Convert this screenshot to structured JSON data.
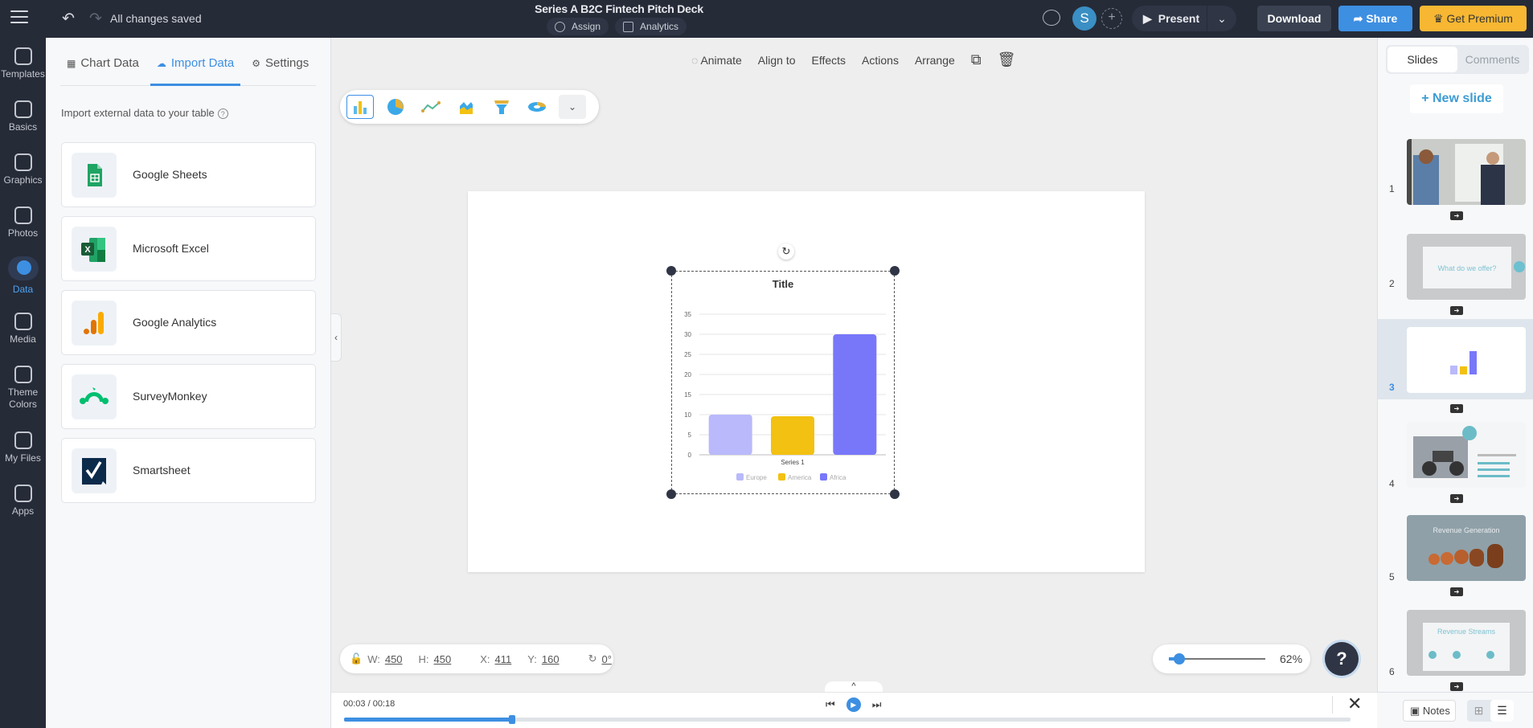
{
  "topbar": {
    "save_status": "All changes saved",
    "doc_title": "Series A B2C Fintech Pitch Deck",
    "assign_label": "Assign",
    "analytics_label": "Analytics",
    "avatar_initial": "S",
    "present_label": "Present",
    "download_label": "Download",
    "share_label": "Share",
    "premium_label": "Get Premium"
  },
  "leftnav": {
    "items": [
      {
        "label": "Templates",
        "icon": "templates-icon"
      },
      {
        "label": "Basics",
        "icon": "text-icon"
      },
      {
        "label": "Graphics",
        "icon": "shapes-icon"
      },
      {
        "label": "Photos",
        "icon": "photo-icon"
      },
      {
        "label": "Data",
        "icon": "pie-chart-icon",
        "active": true
      },
      {
        "label": "Media",
        "icon": "media-icon"
      },
      {
        "label": "Theme Colors",
        "icon": "theme-icon"
      },
      {
        "label": "My Files",
        "icon": "folder-icon"
      },
      {
        "label": "Apps",
        "icon": "apps-icon"
      }
    ]
  },
  "panel": {
    "tabs": [
      {
        "label": "Chart Data",
        "icon": "table-icon"
      },
      {
        "label": "Import Data",
        "icon": "cloud-upload-icon",
        "active": true
      },
      {
        "label": "Settings",
        "icon": "gear-icon"
      }
    ],
    "import_label": "Import external data to your table",
    "sources": [
      {
        "name": "Google Sheets"
      },
      {
        "name": "Microsoft Excel"
      },
      {
        "name": "Google Analytics"
      },
      {
        "name": "SurveyMonkey"
      },
      {
        "name": "Smartsheet"
      }
    ]
  },
  "context_toolbar": {
    "animate": "Animate",
    "align": "Align to",
    "effects": "Effects",
    "actions": "Actions",
    "arrange": "Arrange"
  },
  "chart_types": [
    "bar",
    "pie",
    "line",
    "area",
    "funnel",
    "donut"
  ],
  "chart_data": {
    "type": "bar",
    "title": "Title",
    "categories": [
      "Series 1"
    ],
    "series": [
      {
        "name": "Europe",
        "values": [
          10
        ],
        "color": "#b9b9fb"
      },
      {
        "name": "America",
        "values": [
          9.6
        ],
        "color": "#f2c111"
      },
      {
        "name": "Africa",
        "values": [
          30
        ],
        "color": "#7877fa"
      }
    ],
    "xlabel": "",
    "ylabel": "",
    "ylim": [
      0,
      35
    ],
    "yticks": [
      0,
      5,
      10,
      15,
      20,
      25,
      30,
      35
    ],
    "grid": true,
    "legend": "bottom"
  },
  "geometry_bar": {
    "w_label": "W:",
    "w": "450",
    "h_label": "H:",
    "h": "450",
    "x_label": "X:",
    "x": "411",
    "y_label": "Y:",
    "y": "160",
    "rotation": "0°"
  },
  "zoom": {
    "percent": "62%",
    "level": 0.06
  },
  "help_label": "?",
  "timeline": {
    "time": "00:03 / 00:18",
    "progress": 0.1667
  },
  "right_panel": {
    "tabs": [
      {
        "label": "Slides",
        "active": true
      },
      {
        "label": "Comments"
      }
    ],
    "new_slide": "+ New slide",
    "slides": [
      {
        "num": "1",
        "caption": ""
      },
      {
        "num": "2",
        "caption": "What do we offer?"
      },
      {
        "num": "3",
        "caption": "",
        "active": true
      },
      {
        "num": "4",
        "caption": ""
      },
      {
        "num": "5",
        "caption": "Revenue Generation"
      },
      {
        "num": "6",
        "caption": "Revenue Streams"
      }
    ],
    "notes_label": "Notes"
  }
}
